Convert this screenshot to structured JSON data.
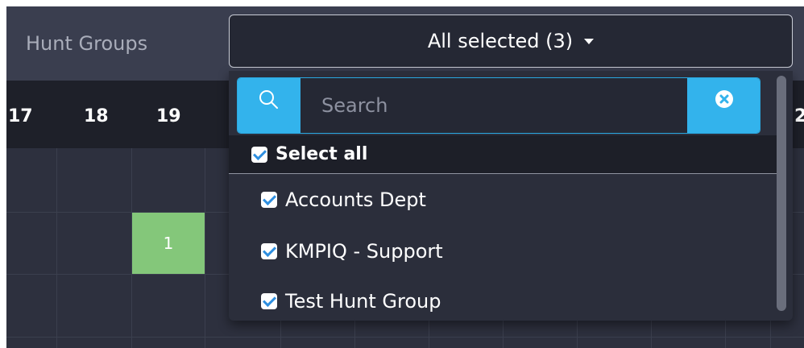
{
  "filter": {
    "label": "Hunt Groups",
    "button_label": "All selected (3)"
  },
  "hours": [
    "17",
    "18",
    "19",
    "2"
  ],
  "grid": {
    "cell_value": "1",
    "cell_color": "#84c77a"
  },
  "dropdown": {
    "search_placeholder": "Search",
    "search_icon": "search-icon",
    "clear_icon": "clear-circle-x-icon",
    "select_all_label": "Select all",
    "options": [
      {
        "label": "Accounts Dept",
        "checked": true
      },
      {
        "label": "KMPIQ - Support",
        "checked": true
      },
      {
        "label": "Test Hunt Group",
        "checked": true
      }
    ],
    "accent_color": "#33b3ec"
  }
}
